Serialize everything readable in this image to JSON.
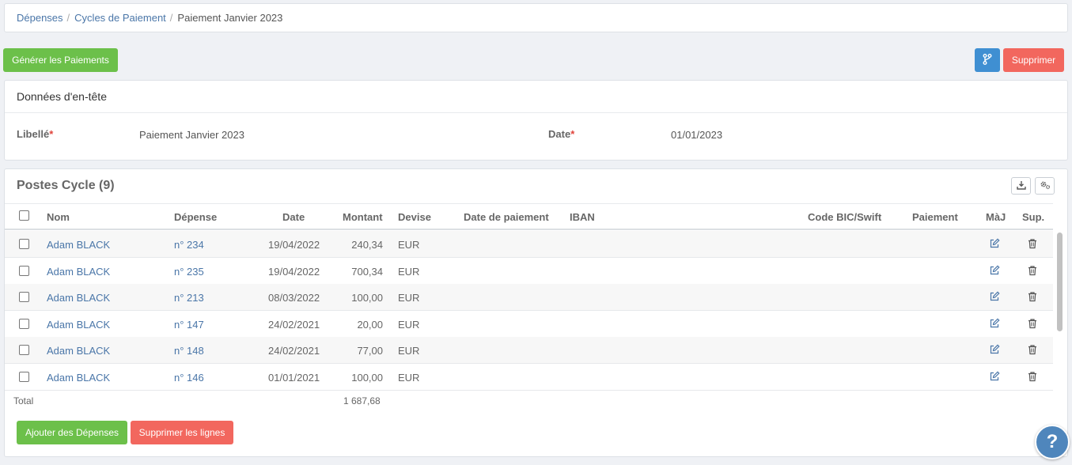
{
  "breadcrumb": {
    "items": [
      {
        "label": "Dépenses"
      },
      {
        "label": "Cycles de Paiement"
      },
      {
        "label": "Paiement Janvier 2023"
      }
    ],
    "separator": "/"
  },
  "toolbar": {
    "generate_label": "Générer les Paiements",
    "branch_icon": "code-branch-icon",
    "delete_label": "Supprimer"
  },
  "header_panel": {
    "title": "Données d'en-tête",
    "fields": {
      "libelle": {
        "label": "Libellé",
        "required_mark": "*",
        "value": "Paiement Janvier 2023"
      },
      "date": {
        "label": "Date",
        "required_mark": "*",
        "value": "01/01/2023"
      }
    }
  },
  "postes": {
    "title": "Postes Cycle (9)",
    "tools": [
      "download-icon",
      "settings-icon"
    ],
    "columns": {
      "nom": "Nom",
      "depense": "Dépense",
      "date": "Date",
      "montant": "Montant",
      "devise": "Devise",
      "date_paiement": "Date de paiement",
      "iban": "IBAN",
      "bic": "Code BIC/Swift",
      "paiement": "Paiement",
      "maj": "MàJ",
      "sup": "Sup."
    },
    "rows": [
      {
        "nom": "Adam BLACK",
        "depense": "n° 234",
        "date": "19/04/2022",
        "montant": "240,34",
        "devise": "EUR"
      },
      {
        "nom": "Adam BLACK",
        "depense": "n° 235",
        "date": "19/04/2022",
        "montant": "700,34",
        "devise": "EUR"
      },
      {
        "nom": "Adam BLACK",
        "depense": "n° 213",
        "date": "08/03/2022",
        "montant": "100,00",
        "devise": "EUR"
      },
      {
        "nom": "Adam BLACK",
        "depense": "n° 147",
        "date": "24/02/2021",
        "montant": "20,00",
        "devise": "EUR"
      },
      {
        "nom": "Adam BLACK",
        "depense": "n° 148",
        "date": "24/02/2021",
        "montant": "77,00",
        "devise": "EUR"
      },
      {
        "nom": "Adam BLACK",
        "depense": "n° 146",
        "date": "01/01/2021",
        "montant": "100,00",
        "devise": "EUR"
      }
    ],
    "total_label": "Total",
    "total_value": "1 687,68",
    "add_label": "Ajouter des Dépenses",
    "remove_label": "Supprimer les lignes"
  },
  "help_label": "?",
  "colors": {
    "green": "#6cc04a",
    "red": "#f2675e",
    "blue": "#3f8fd2",
    "link": "#4a76a8",
    "help": "#4f86bc"
  }
}
